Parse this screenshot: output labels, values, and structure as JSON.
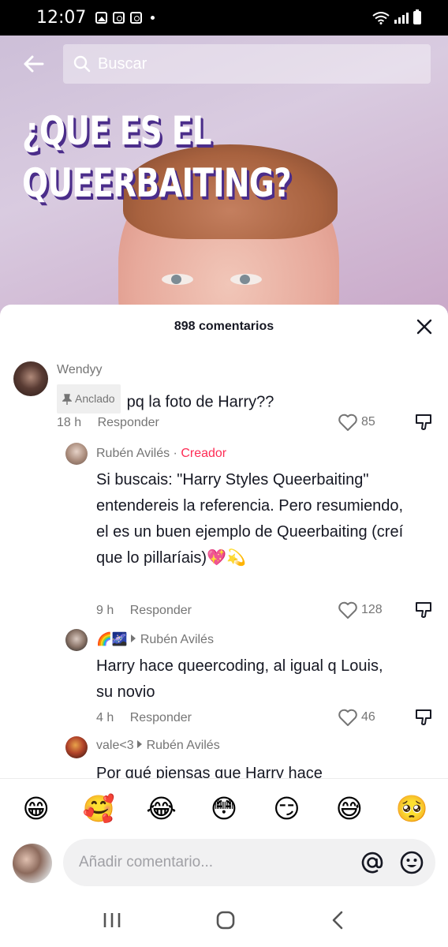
{
  "status_bar": {
    "time": "12:07"
  },
  "video": {
    "title_line1": "¿QUE ES EL",
    "title_line2": "QUEERBAITING?",
    "search_placeholder": "Buscar"
  },
  "sheet": {
    "comment_count": "898 comentarios",
    "comments": [
      {
        "user": "Wendyy",
        "pinned_label": "Anclado",
        "text": "pq la foto de Harry??",
        "time": "18 h",
        "reply_label": "Responder",
        "likes": "85"
      },
      {
        "user": "Rubén Avilés",
        "separator": " · ",
        "tag": "Creador",
        "text": "Si buscais: \"Harry Styles Queerbaiting\" entendereis la referencia. Pero resumiendo, el es un buen ejemplo de Queerbaiting (creí que lo pillaríais)💖💫",
        "time": "9 h",
        "reply_label": "Responder",
        "likes": "128"
      },
      {
        "user": "🌈🌌",
        "reply_to": "Rubén Avilés",
        "text": "Harry hace queercoding, al igual q Louis, su novio",
        "time": "4 h",
        "reply_label": "Responder",
        "likes": "46"
      },
      {
        "user": "vale<3",
        "reply_to": "Rubén Avilés",
        "text": "Por qué piensas que Harry hace"
      }
    ]
  },
  "emojis": [
    "😁",
    "🥰",
    "😂",
    "😳",
    "😏",
    "😅",
    "🥺"
  ],
  "input": {
    "placeholder": "Añadir comentario..."
  },
  "colors": {
    "accent": "#fe2c55",
    "text": "#161823",
    "muted": "#757575"
  }
}
